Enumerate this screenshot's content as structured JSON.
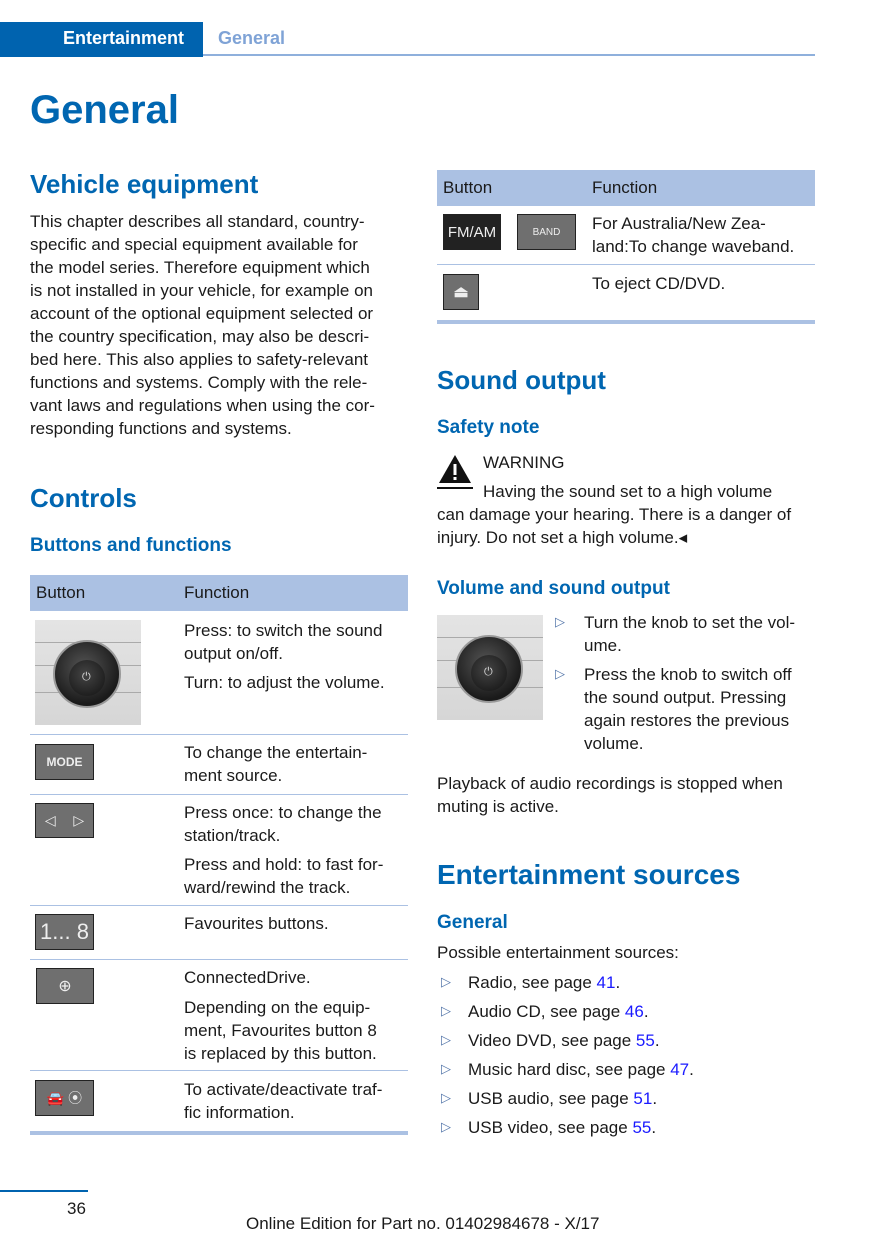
{
  "header": {
    "section": "Entertainment",
    "subsection": "General"
  },
  "title": "General",
  "vehicle_equipment": {
    "heading": "Vehicle equipment",
    "text": "This chapter describes all standard, country-\nspecific and special equipment available for\nthe model series. Therefore equipment which\nis not installed in your vehicle, for example on\naccount of the optional equipment selected or\nthe country specification, may also be descri-\nbed here. This also applies to safety-relevant\nfunctions and systems. Comply with the rele-\nvant laws and regulations when using the cor-\nresponding functions and systems."
  },
  "controls": {
    "heading": "Controls",
    "subheading": "Buttons and functions",
    "table_headers": [
      "Button",
      "Function"
    ],
    "rows": [
      {
        "icon": "volume-knob",
        "lines": [
          "Press: to switch the sound\noutput on/off.",
          "Turn: to adjust the volume."
        ]
      },
      {
        "icon": "mode-button",
        "button_label": "MODE",
        "lines": [
          "To change the entertain-\nment source."
        ]
      },
      {
        "icon": "prev-next-buttons",
        "lines": [
          "Press once: to change the\nstation/track.",
          "Press and hold: to fast for-\nward/rewind the track."
        ]
      },
      {
        "icon": "favourites-button",
        "button_label": "1... 8",
        "lines": [
          "Favourites buttons."
        ]
      },
      {
        "icon": "connecteddrive-globe-button",
        "lines": [
          "ConnectedDrive.",
          "Depending on the equip-\nment, Favourites button 8\nis replaced by this button."
        ]
      },
      {
        "icon": "traffic-info-button",
        "lines": [
          "To activate/deactivate traf-\nfic information."
        ]
      }
    ]
  },
  "right_table": {
    "headers": [
      "Button",
      "Function"
    ],
    "rows": [
      {
        "icons": [
          "fm-am-button",
          "band-button"
        ],
        "button_labels": [
          "FM/AM",
          "BAND"
        ],
        "text": "For Australia/New Zea-\nland:To change waveband."
      },
      {
        "icons": [
          "eject-button"
        ],
        "text": "To eject CD/DVD."
      }
    ]
  },
  "sound_output": {
    "heading": "Sound output",
    "safety_heading": "Safety note",
    "warning_label": "WARNING",
    "warning_first": "Having the sound set to a high volume",
    "warning_rest": "can damage your hearing. There is a danger of\ninjury. Do not set a high volume.◂",
    "volume_heading": "Volume and sound output",
    "bullets": [
      "Turn the knob to set the vol-\nume.",
      "Press the knob to switch off\nthe sound output. Pressing\nagain restores the previous\nvolume."
    ],
    "playback_text": "Playback of audio recordings is stopped when\nmuting is active."
  },
  "sources": {
    "heading": "Entertainment sources",
    "subheading": "General",
    "intro": "Possible entertainment sources:",
    "items": [
      {
        "text": "Radio, see page ",
        "page": "41"
      },
      {
        "text": "Audio CD, see page ",
        "page": "46"
      },
      {
        "text": "Video DVD, see page ",
        "page": "55"
      },
      {
        "text": "Music hard disc, see page ",
        "page": "47"
      },
      {
        "text": "USB audio, see page ",
        "page": "51"
      },
      {
        "text": "USB video, see page ",
        "page": "55"
      }
    ]
  },
  "footer": {
    "page_number": "36",
    "edition": "Online Edition for Part no. 01402984678 - X/17"
  },
  "colors": {
    "brand_blue": "#0066b1",
    "table_header": "#abc1e3",
    "link": "#1a1aff"
  }
}
